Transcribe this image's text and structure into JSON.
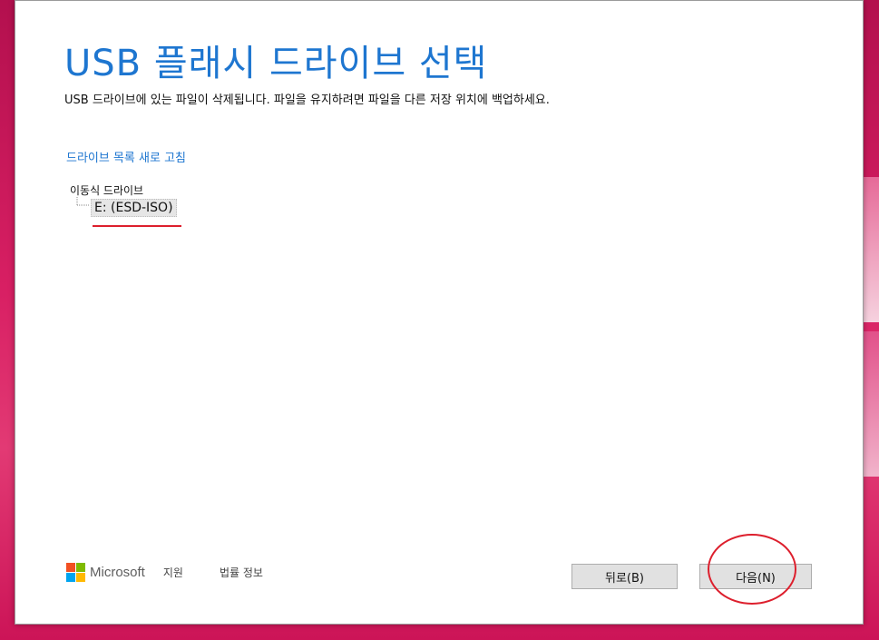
{
  "dialog": {
    "title": "USB 플래시 드라이브 선택",
    "subtitle": "USB 드라이브에 있는 파일이 삭제됩니다. 파일을 유지하려면 파일을 다른 저장 위치에 백업하세요.",
    "refresh_link": "드라이브 목록 새로 고침",
    "tree": {
      "root_label": "이동식 드라이브",
      "items": [
        {
          "label": "E: (ESD-ISO)",
          "selected": true
        }
      ]
    },
    "footer": {
      "brand": "Microsoft",
      "links": [
        "지원",
        "법률 정보"
      ]
    },
    "buttons": {
      "back": "뒤로(B)",
      "next": "다음(N)"
    }
  },
  "colors": {
    "accent": "#1e76d0",
    "annotation_red": "#dd1f2d",
    "ms_red": "#f25022",
    "ms_green": "#7fba00",
    "ms_blue": "#00a4ef",
    "ms_yellow": "#ffb900"
  }
}
